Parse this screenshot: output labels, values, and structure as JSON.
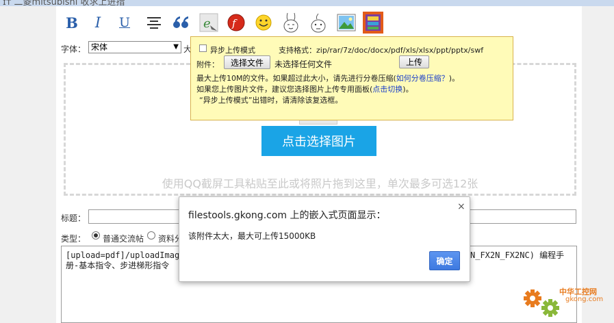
{
  "header": {
    "title_fragment": "ɪᴛ 二菱mitsubishi 收求上进措"
  },
  "toolbar": {
    "bold": "B",
    "italic": "I",
    "underline": "U"
  },
  "format": {
    "font_label": "字体：",
    "font_value": "宋体",
    "size_label_fragment": "大"
  },
  "upload": {
    "choose_image_button": "点击选择图片",
    "drop_hint": "使用QQ截屏工具粘贴至此或将照片拖到这里，单次最多可选12张"
  },
  "attachment_popup": {
    "async_label": "异步上传模式",
    "supported_formats": "支持格式：zip/rar/7z/doc/docx/pdf/xls/xlsx/ppt/pptx/swf",
    "attachment_label": "附件：",
    "choose_file_button": "选择文件",
    "no_file_text": "未选择任何文件",
    "upload_button": "上传",
    "max_size_text": "最大上传10M的文件。如果超过此大小，请先进行分卷压缩(",
    "split_link": "如何分卷压缩？",
    "max_size_tail": ")。",
    "image_hint_text": "如果您上传图片文件，建议您选择图片上传专用面板(",
    "switch_link": "点击切换",
    "image_hint_tail": ")。",
    "async_error_hint": "“异步上传模式”出错时，请清除该复选框。"
  },
  "post_form": {
    "title_label": "标题：",
    "type_label": "类型：",
    "type_options": [
      "普通交流帖",
      "资料分"
    ],
    "content_line1_left": "[upload=pdf]/uploadImages",
    "content_line1_right": "N_FX2N_FX2NC) 编程手",
    "content_line2": "册-基本指令、步进梯形指令"
  },
  "alert": {
    "title": "filestools.gkong.com 上的嵌入式页面显示：",
    "message": "该附件太大，最大可上传15000KB",
    "close": "×",
    "ok_button": "确定"
  },
  "watermark": {
    "text": "中华工控网",
    "domain": "gkong.com",
    "color": "#e87b1e"
  },
  "colors": {
    "accent_button": "#1aa4e6",
    "popup_bg": "#fffbb8",
    "dialog_ok": "#3d79e0"
  }
}
